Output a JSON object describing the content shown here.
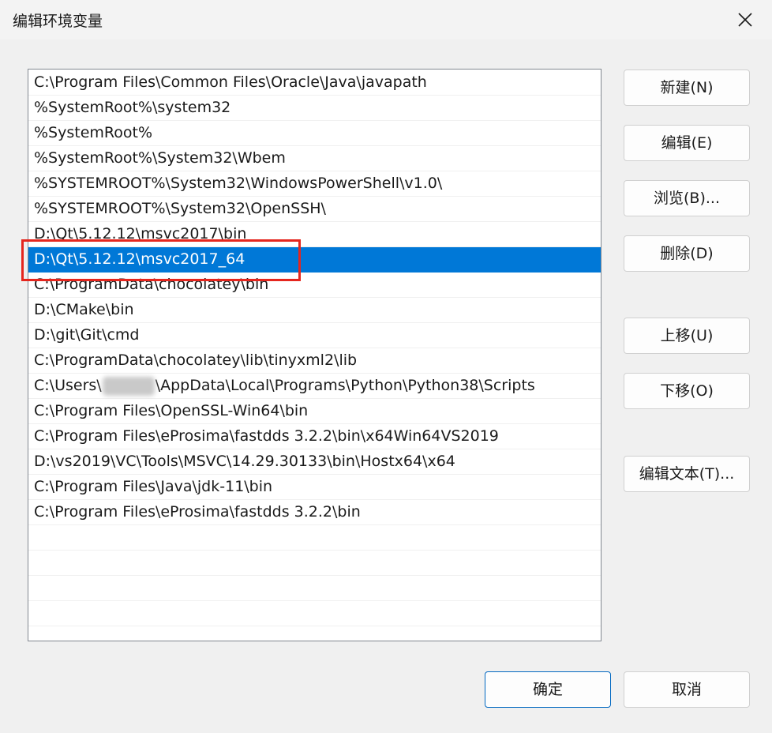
{
  "window": {
    "title": "编辑环境变量",
    "close_icon": "close-icon"
  },
  "path_list": {
    "selected_index": 7,
    "items": [
      {
        "text": "C:\\Program Files\\Common Files\\Oracle\\Java\\javapath"
      },
      {
        "text": "%SystemRoot%\\system32"
      },
      {
        "text": "%SystemRoot%"
      },
      {
        "text": "%SystemRoot%\\System32\\Wbem"
      },
      {
        "text": "%SYSTEMROOT%\\System32\\WindowsPowerShell\\v1.0\\"
      },
      {
        "text": "%SYSTEMROOT%\\System32\\OpenSSH\\"
      },
      {
        "text": "D:\\Qt\\5.12.12\\msvc2017\\bin"
      },
      {
        "text": "D:\\Qt\\5.12.12\\msvc2017_64"
      },
      {
        "text": "C:\\ProgramData\\chocolatey\\bin"
      },
      {
        "text": "D:\\CMake\\bin"
      },
      {
        "text": "D:\\git\\Git\\cmd"
      },
      {
        "text": "C:\\ProgramData\\chocolatey\\lib\\tinyxml2\\lib"
      },
      {
        "text_before": "C:\\Users\\",
        "text_after": "\\AppData\\Local\\Programs\\Python\\Python38\\Scripts"
      },
      {
        "text": "C:\\Program Files\\OpenSSL-Win64\\bin"
      },
      {
        "text": "C:\\Program Files\\eProsima\\fastdds 3.2.2\\bin\\x64Win64VS2019"
      },
      {
        "text": "D:\\vs2019\\VC\\Tools\\MSVC\\14.29.30133\\bin\\Hostx64\\x64"
      },
      {
        "text": "C:\\Program Files\\Java\\jdk-11\\bin"
      },
      {
        "text": "C:\\Program Files\\eProsima\\fastdds 3.2.2\\bin"
      },
      {
        "text": ""
      },
      {
        "text": ""
      },
      {
        "text": ""
      },
      {
        "text": ""
      },
      {
        "text": ""
      }
    ]
  },
  "buttons": {
    "new": "新建(N)",
    "edit": "编辑(E)",
    "browse": "浏览(B)...",
    "delete": "删除(D)",
    "move_up": "上移(U)",
    "move_down": "下移(O)",
    "edit_text": "编辑文本(T)...",
    "ok": "确定",
    "cancel": "取消"
  },
  "colors": {
    "selection": "#0078d7",
    "annotation_box": "#e5261e",
    "primary_border": "#0067c0"
  }
}
